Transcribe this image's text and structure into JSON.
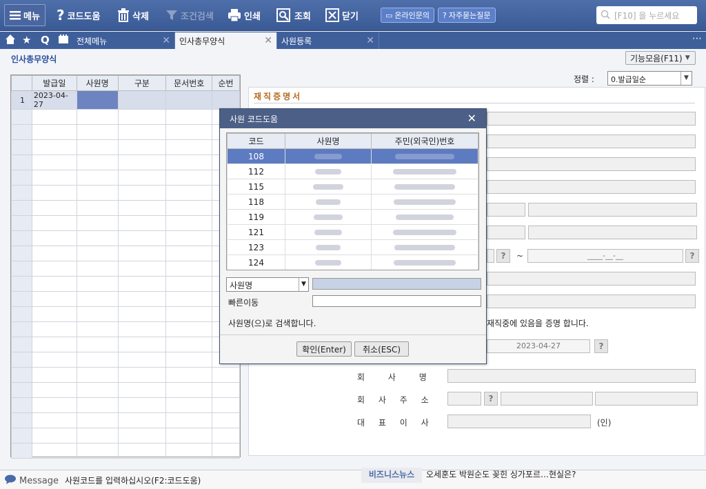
{
  "toolbar": {
    "menu_label": "메뉴",
    "code_help": "코드도움",
    "delete": "삭제",
    "condition_search": "조건검색",
    "print": "인쇄",
    "lookup": "조회",
    "close": "닫기",
    "online_inquiry": "온라인문의",
    "faq": "자주묻는질문",
    "search_placeholder": "[F10] 을 누르세요"
  },
  "tabs": [
    {
      "label": "전체메뉴"
    },
    {
      "label": "인사총무양식"
    },
    {
      "label": "사원등록"
    }
  ],
  "page": {
    "title": "인사총무양식",
    "func_button": "기능모음(F11)"
  },
  "left_grid": {
    "columns": [
      "발급일",
      "사원명",
      "구분",
      "문서번호",
      "순번"
    ],
    "rows": [
      {
        "num": "1",
        "date": "2023-04-27"
      }
    ]
  },
  "right_panel": {
    "sort_label": "정렬 :",
    "sort_value": "0.발급일순",
    "title": "재직증명서",
    "range_sep": "~",
    "range_placeholder": "____-__-__",
    "cert_text": "재직중에 있음을 증명 합니다.",
    "issue_date": "2023-04-27",
    "company_name_label": "회 사 명",
    "company_addr_label": "회 사 주 소",
    "ceo_label": "대 표 이 사",
    "seal": "(인)",
    "help_icon_text": "?"
  },
  "modal": {
    "title": "사원 코드도움",
    "columns": [
      "코드",
      "사원명",
      "주민(외국인)번호"
    ],
    "rows": [
      {
        "code": "108"
      },
      {
        "code": "112"
      },
      {
        "code": "115"
      },
      {
        "code": "118"
      },
      {
        "code": "119"
      },
      {
        "code": "121"
      },
      {
        "code": "123"
      },
      {
        "code": "124"
      }
    ],
    "search_field": "사원명",
    "quick_move_label": "빠른이동",
    "hint": "사원명(으)로 검색합니다.",
    "ok_button": "확인(Enter)",
    "cancel_button": "취소(ESC)"
  },
  "status": {
    "message_label": "Message",
    "message_text": "사원코드를 입력하십시오(F2:코드도움)",
    "biz_label": "비즈니스뉴스",
    "biz_text": "오세훈도 박원순도 꽂힌 싱가포르…현실은?"
  },
  "colors": {
    "toolbar_bg": "#3f5f9b",
    "selection": "#5d7bc1",
    "title_orange": "#b86a1d"
  }
}
